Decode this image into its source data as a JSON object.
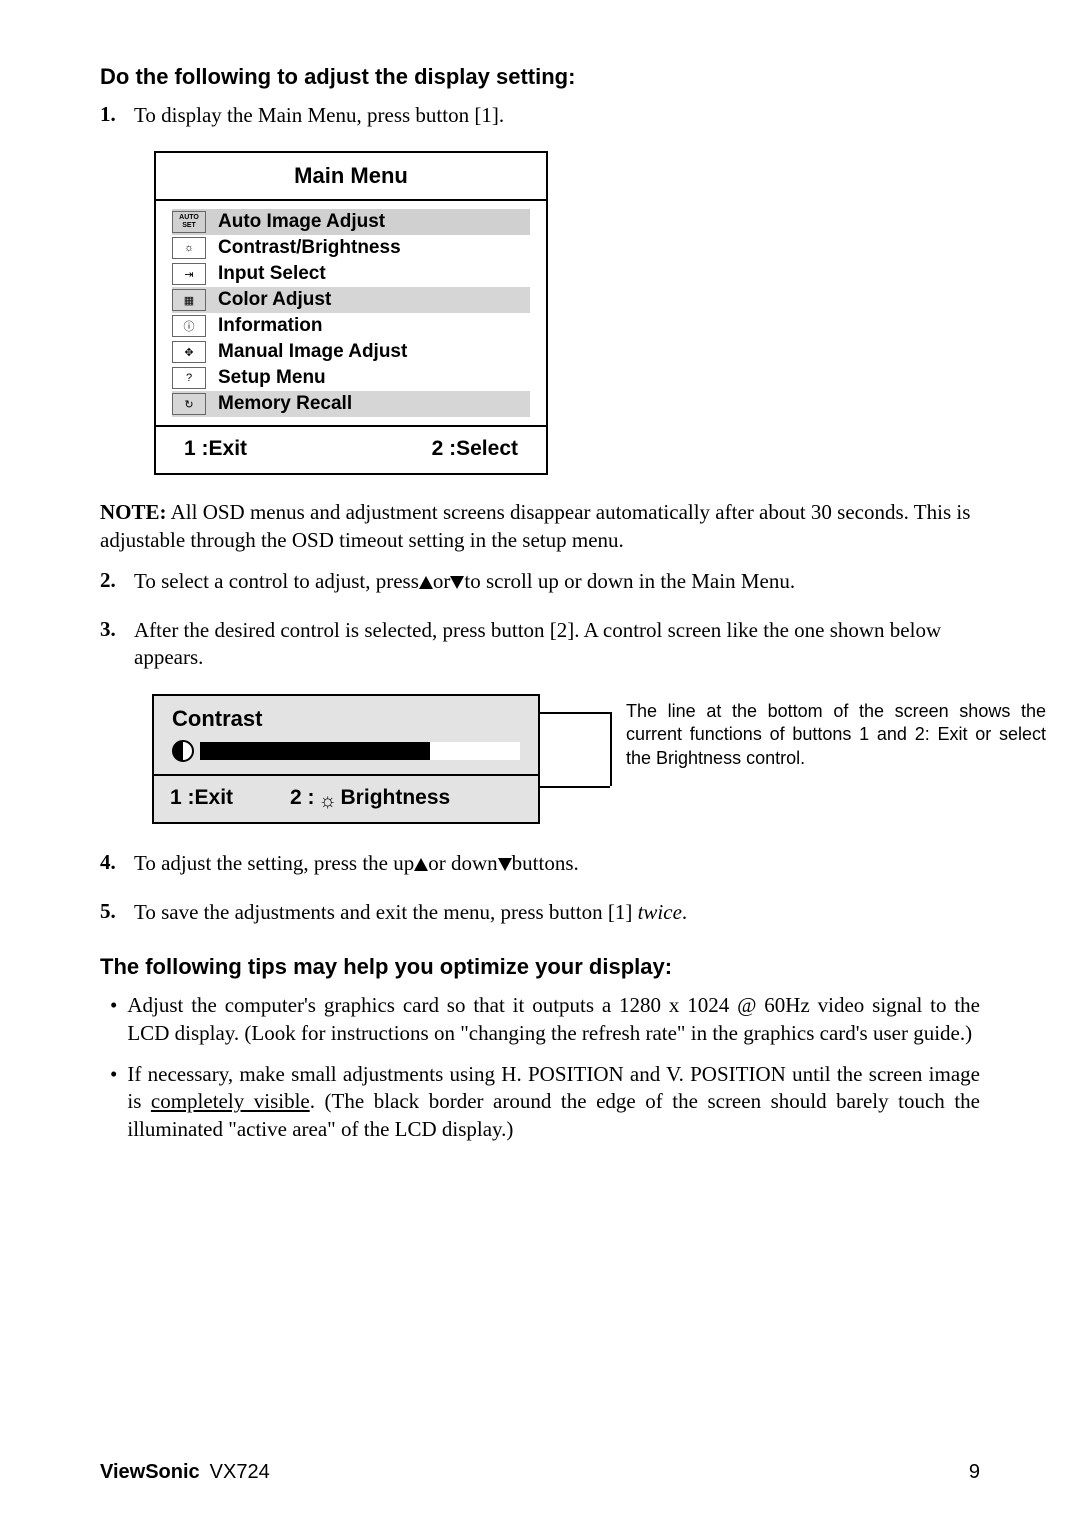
{
  "h2_adjust": "Do the following to adjust the display setting:",
  "step1_num": "1.",
  "step1_txt": "To display the Main Menu, press button [1].",
  "menu": {
    "title": "Main Menu",
    "items": [
      {
        "icon": "AUTO SET",
        "label": "Auto Image Adjust",
        "sel": true
      },
      {
        "icon": "☼",
        "label": "Contrast/Brightness"
      },
      {
        "icon": "⇥",
        "label": "Input Select"
      },
      {
        "icon": "▦",
        "label": "Color Adjust"
      },
      {
        "icon": "ⓘ",
        "label": "Information"
      },
      {
        "icon": "✥",
        "label": "Manual Image Adjust"
      },
      {
        "icon": "?",
        "label": "Setup Menu"
      },
      {
        "icon": "↻",
        "label": "Memory Recall"
      }
    ],
    "foot_left": "1 :Exit",
    "foot_right": "2 :Select"
  },
  "note_label": "NOTE:",
  "note_body": " All OSD menus and adjustment screens disappear automatically after about 30 seconds. This is adjustable through the OSD timeout setting in the setup menu.",
  "step2_num": "2.",
  "step2_a": "To select a control to adjust, press",
  "step2_b": "or",
  "step2_c": "to scroll up or down in the Main Menu.",
  "step3_num": "3.",
  "step3_txt": "After the desired control is selected, press button [2]. A control screen like the one shown below appears.",
  "contrast": {
    "title": "Contrast",
    "fill_white_pct": 28,
    "foot_left": "1 :Exit",
    "foot_b_pre": "2 :",
    "foot_b_label": " Brightness"
  },
  "caption": "The line at the bottom of the screen shows the current functions of buttons 1 and 2: Exit or select the Brightness control.",
  "step4_num": "4.",
  "step4_a": "To adjust the setting, press the up",
  "step4_b": "or down",
  "step4_c": "buttons.",
  "step5_num": "5.",
  "step5_a": "To save the adjustments and exit the menu, press button [1] ",
  "step5_twice": "twice",
  "step5_dot": ".",
  "h2_tips": "The following tips may help you optimize your display:",
  "tip1": "Adjust the computer's graphics card so that it outputs a 1280 x 1024 @ 60Hz video signal to the LCD display. (Look for instructions on \"changing the refresh rate\" in the graphics card's user guide.)",
  "tip2_a": "If necessary, make small adjustments using H. POSITION and V. POSITION until the screen image is ",
  "tip2_u": "completely visible",
  "tip2_b": ". (The black border around the edge of the screen should barely touch the illuminated \"active area\" of the LCD display.)",
  "footer_brand": "ViewSonic",
  "footer_model": "VX724",
  "footer_page": "9"
}
